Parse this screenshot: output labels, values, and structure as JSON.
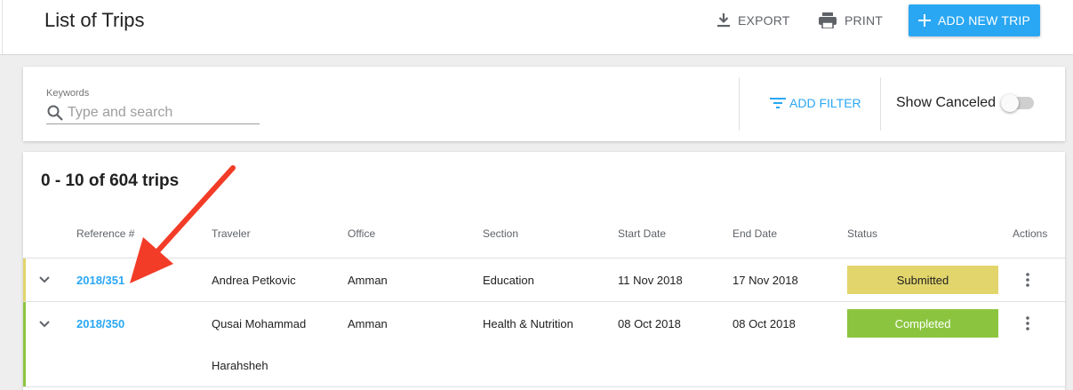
{
  "header": {
    "title": "List of Trips",
    "export_label": "EXPORT",
    "print_label": "PRINT",
    "add_trip_label": "ADD NEW TRIP"
  },
  "filters": {
    "keywords_label": "Keywords",
    "search_placeholder": "Type and search",
    "search_value": "",
    "add_filter_label": "ADD FILTER",
    "show_canceled_label": "Show Canceled",
    "show_canceled_on": false
  },
  "table": {
    "count_text": "0 - 10 of 604 trips",
    "columns": [
      "Reference #",
      "Traveler",
      "Office",
      "Section",
      "Start Date",
      "End Date",
      "Status",
      "Actions"
    ],
    "rows": [
      {
        "reference": "2018/351",
        "traveler": "Andrea Petkovic",
        "office": "Amman",
        "section": "Education",
        "start_date": "11 Nov 2018",
        "end_date": "17 Nov 2018",
        "status": "Submitted",
        "status_color": "#e2d56b",
        "status_text_color": "#212121",
        "row_bar_color": "#e2d56b"
      },
      {
        "reference": "2018/350",
        "traveler": "Qusai Mohammad",
        "traveler_line2": "Harahsheh",
        "office": "Amman",
        "section": "Health & Nutrition",
        "start_date": "08 Oct 2018",
        "end_date": "08 Oct 2018",
        "status": "Completed",
        "status_color": "#8bc53f",
        "status_text_color": "#ffffff",
        "row_bar_color": "#8bc53f"
      }
    ]
  },
  "annotation": {
    "arrow_color": "#f23c28"
  },
  "colors": {
    "accent": "#2aa7f3"
  },
  "icons": [
    "download-icon",
    "print-icon",
    "plus-icon",
    "search-icon",
    "filter-icon",
    "chevron-down-icon",
    "more-vert-icon"
  ]
}
